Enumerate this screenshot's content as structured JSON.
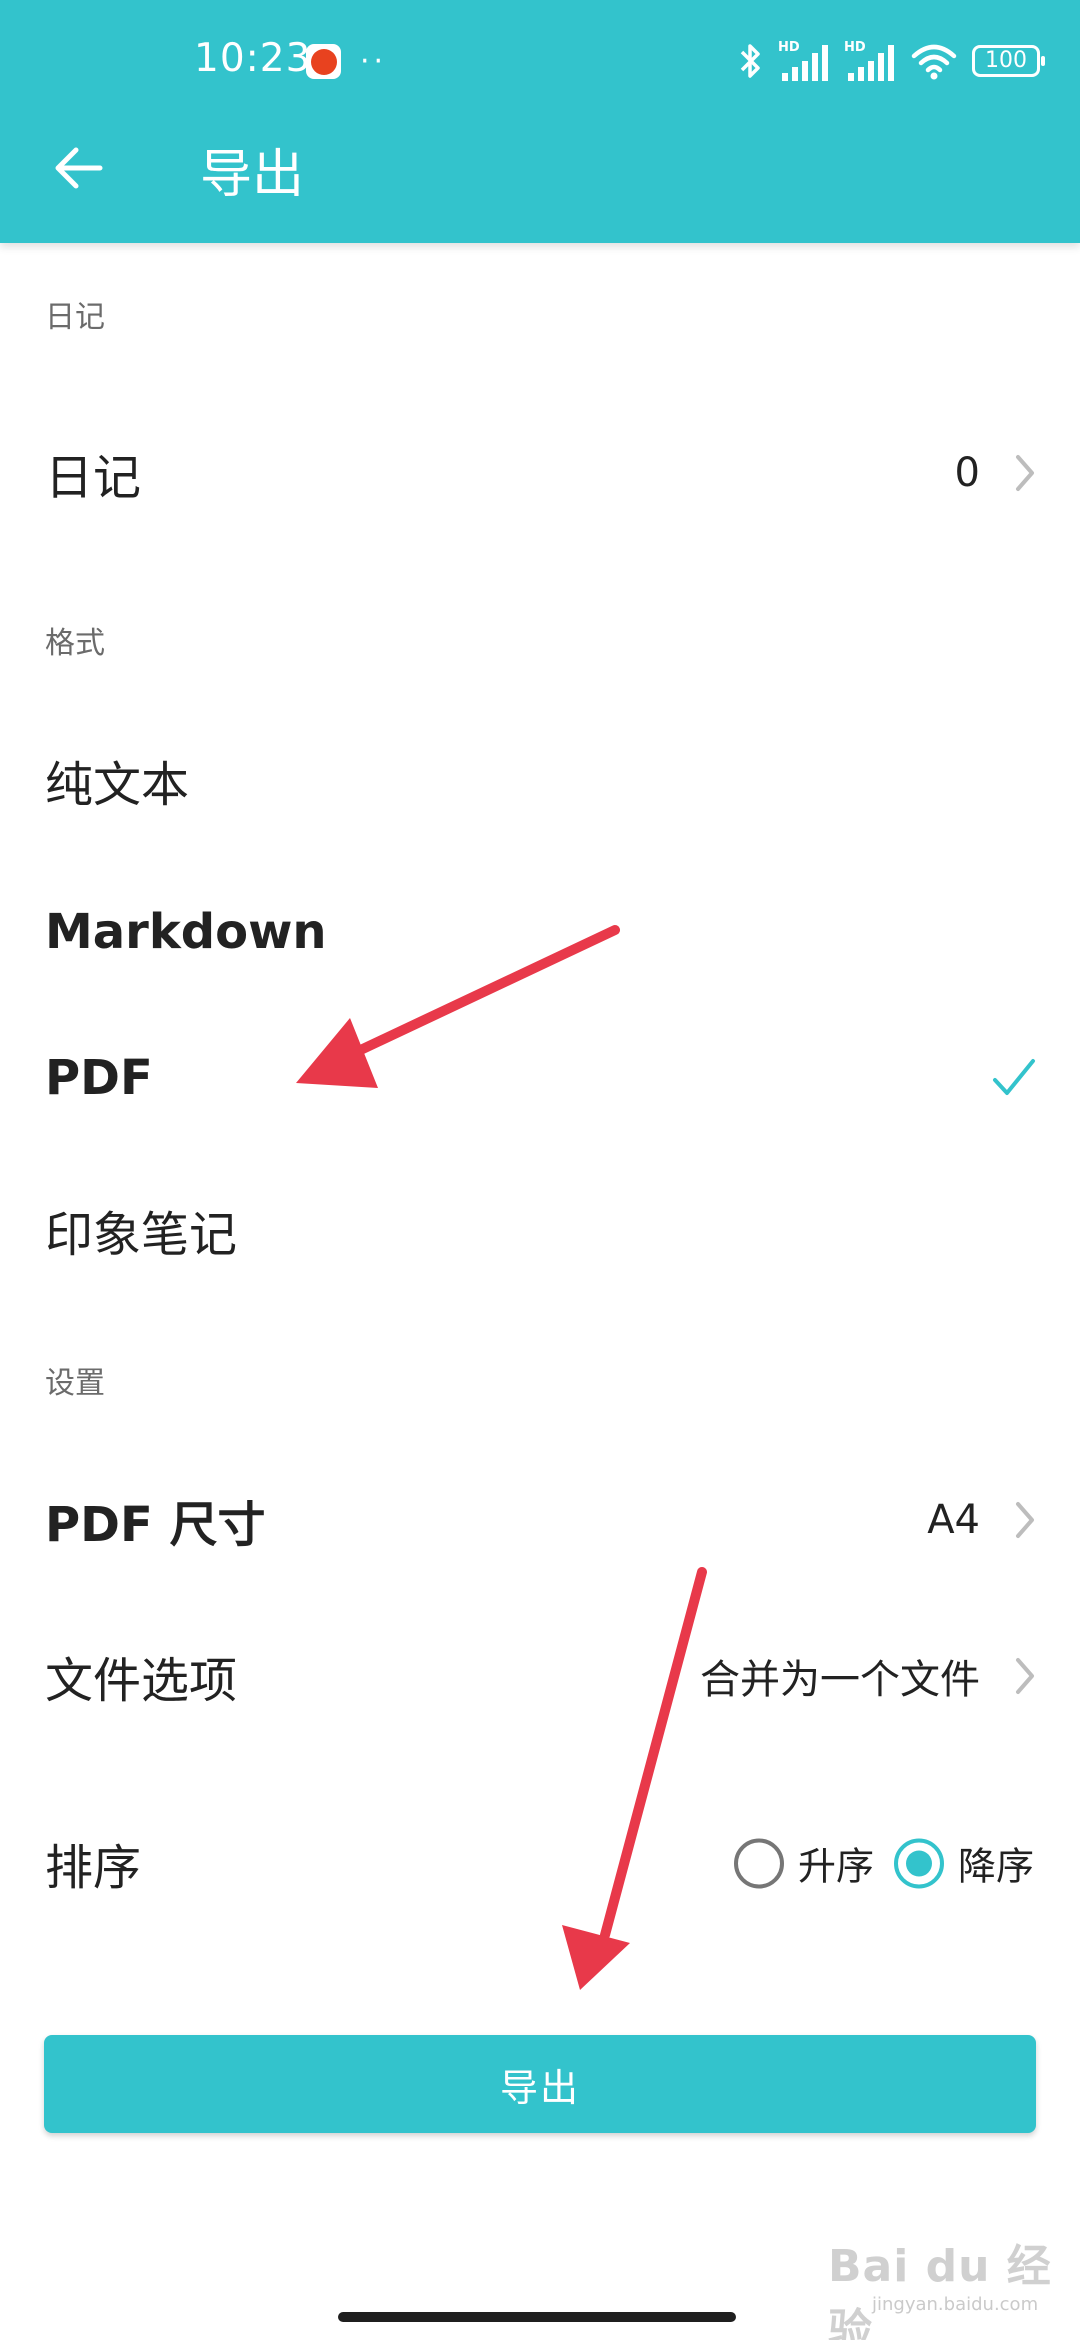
{
  "colors": {
    "accent": "#33c3cc",
    "annotation": "#e8394a",
    "check": "#33c3cc"
  },
  "status_bar": {
    "time": "10:23",
    "dots": "··",
    "battery": "100",
    "hd1": "HD",
    "hd2": "HD"
  },
  "header": {
    "title": "导出",
    "back_icon": "arrow-left-icon"
  },
  "sections": {
    "diary": {
      "label": "日记"
    },
    "format": {
      "label": "格式"
    },
    "settings": {
      "label": "设置"
    }
  },
  "diary_row": {
    "label": "日记",
    "value": "0"
  },
  "formats": [
    {
      "label": "纯文本",
      "selected": false
    },
    {
      "label": "Markdown",
      "selected": false
    },
    {
      "label": "PDF",
      "selected": true
    },
    {
      "label": "印象笔记",
      "selected": false
    }
  ],
  "settings": {
    "pdf_size": {
      "label": "PDF 尺寸",
      "value": "A4"
    },
    "file_option": {
      "label": "文件选项",
      "value": "合并为一个文件"
    },
    "sort": {
      "label": "排序",
      "options": [
        {
          "label": "升序",
          "checked": false
        },
        {
          "label": "降序",
          "checked": true
        }
      ]
    }
  },
  "export_button": {
    "label": "导出"
  },
  "watermark": {
    "text": "Bai du 经验",
    "sub": "jingyan.baidu.com"
  }
}
